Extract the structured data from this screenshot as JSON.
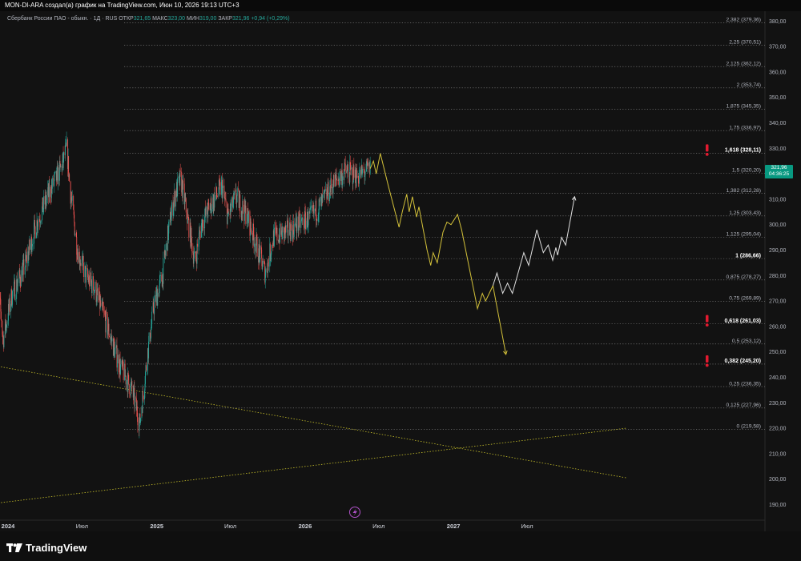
{
  "header": {
    "creator_line": "MON-DI-ARA создал(а) график на TradingView.com, Июн 10, 2026 19:13 UTC+3"
  },
  "legend": {
    "symbol": "Сбербанк России ПАО - обыкн. · 1Д · RUS",
    "open_label": "ОТКР",
    "open_value": "321,65",
    "high_label": "МАКС",
    "high_value": "323,00",
    "low_label": "МИН",
    "low_value": "319,00",
    "close_label": "ЗАКР",
    "close_value": "321,96",
    "change": "+0,94 (+0,29%)"
  },
  "price_tag": {
    "price": "321,96",
    "countdown": "04:36:25"
  },
  "brand": {
    "logo_text": "TradingView"
  },
  "colors": {
    "up": "#26a69a",
    "down": "#ef5350",
    "projection_yellow": "#d4c23a",
    "projection_white": "#e0e0e0",
    "fib_line": "#8a8a8a",
    "alert_red": "#e21a2f",
    "trendline": "#c9c22a"
  },
  "chart_data": {
    "type": "candlestick",
    "y_axis_ticks": [
      380,
      370,
      360,
      350,
      340,
      330,
      320,
      310,
      300,
      290,
      280,
      270,
      260,
      250,
      240,
      230,
      220,
      210,
      200,
      190
    ],
    "x_axis_labels": [
      "2024",
      "Июл",
      "2025",
      "Июл",
      "2026",
      "Июл",
      "2027",
      "Июл"
    ],
    "x_axis_label_dates": [
      "2024-01-01",
      "2024-07-01",
      "2025-01-01",
      "2025-07-01",
      "2026-01-01",
      "2026-07-01",
      "2027-01-01",
      "2027-07-01"
    ],
    "ylim": [
      187,
      382
    ],
    "fib_levels": [
      {
        "ratio": "2,382",
        "price": 379.36,
        "label": "2,382 (379,36)",
        "bold": false
      },
      {
        "ratio": "2,25",
        "price": 370.51,
        "label": "2,25 (370,51)",
        "bold": false
      },
      {
        "ratio": "2,125",
        "price": 362.12,
        "label": "2,125 (362,12)",
        "bold": false
      },
      {
        "ratio": "2",
        "price": 353.74,
        "label": "2 (353,74)",
        "bold": false
      },
      {
        "ratio": "1,875",
        "price": 345.35,
        "label": "1,875 (345,35)",
        "bold": false
      },
      {
        "ratio": "1,75",
        "price": 336.97,
        "label": "1,75 (336,97)",
        "bold": false
      },
      {
        "ratio": "1,618",
        "price": 328.11,
        "label": "1,618 (328,11)",
        "bold": true,
        "alert": true
      },
      {
        "ratio": "1,5",
        "price": 320.2,
        "label": "1,5 (320,20)",
        "bold": false
      },
      {
        "ratio": "1,382",
        "price": 312.28,
        "label": "1,382 (312,28)",
        "bold": false
      },
      {
        "ratio": "1,25",
        "price": 303.43,
        "label": "1,25 (303,43)",
        "bold": false
      },
      {
        "ratio": "1,125",
        "price": 295.04,
        "label": "1,125 (295,04)",
        "bold": false
      },
      {
        "ratio": "1",
        "price": 286.66,
        "label": "1 (286,66)",
        "bold": true
      },
      {
        "ratio": "0,875",
        "price": 278.27,
        "label": "0,875 (278,27)",
        "bold": false
      },
      {
        "ratio": "0,75",
        "price": 269.89,
        "label": "0,75 (269,89)",
        "bold": false
      },
      {
        "ratio": "0,618",
        "price": 261.03,
        "label": "0,618 (261,03)",
        "bold": true,
        "alert": true
      },
      {
        "ratio": "0,5",
        "price": 253.12,
        "label": "0,5 (253,12)",
        "bold": false
      },
      {
        "ratio": "0,382",
        "price": 245.2,
        "label": "0,382 (245,20)",
        "bold": true,
        "alert": true
      },
      {
        "ratio": "0,25",
        "price": 236.35,
        "label": "0,25 (236,35)",
        "bold": false
      },
      {
        "ratio": "0,125",
        "price": 227.96,
        "label": "0,125 (227,96)",
        "bold": false
      },
      {
        "ratio": "0",
        "price": 219.58,
        "label": "0 (219,58)",
        "bold": false
      }
    ],
    "price_anchors": [
      [
        "2023-12-01",
        287
      ],
      [
        "2023-12-20",
        255
      ],
      [
        "2024-01-10",
        272
      ],
      [
        "2024-02-10",
        283
      ],
      [
        "2024-03-10",
        300
      ],
      [
        "2024-04-10",
        312
      ],
      [
        "2024-05-10",
        322
      ],
      [
        "2024-05-25",
        330
      ],
      [
        "2024-06-01",
        315
      ],
      [
        "2024-06-20",
        290
      ],
      [
        "2024-07-10",
        280
      ],
      [
        "2024-08-01",
        275
      ],
      [
        "2024-09-01",
        260
      ],
      [
        "2024-10-01",
        245
      ],
      [
        "2024-11-01",
        235
      ],
      [
        "2024-11-20",
        222
      ],
      [
        "2024-12-10",
        250
      ],
      [
        "2024-12-25",
        268
      ],
      [
        "2025-01-15",
        280
      ],
      [
        "2025-02-01",
        300
      ],
      [
        "2025-02-15",
        312
      ],
      [
        "2025-03-01",
        318
      ],
      [
        "2025-03-15",
        305
      ],
      [
        "2025-04-05",
        285
      ],
      [
        "2025-04-20",
        300
      ],
      [
        "2025-05-15",
        308
      ],
      [
        "2025-06-10",
        315
      ],
      [
        "2025-06-25",
        303
      ],
      [
        "2025-07-15",
        311
      ],
      [
        "2025-08-10",
        304
      ],
      [
        "2025-09-01",
        293
      ],
      [
        "2025-09-25",
        281
      ],
      [
        "2025-10-15",
        295
      ],
      [
        "2025-11-15",
        297
      ],
      [
        "2025-12-15",
        300
      ],
      [
        "2026-01-15",
        303
      ],
      [
        "2026-02-10",
        308
      ],
      [
        "2026-03-10",
        316
      ],
      [
        "2026-04-10",
        321
      ],
      [
        "2026-05-10",
        319
      ],
      [
        "2026-06-10",
        322
      ]
    ],
    "projection_yellow": [
      [
        "2026-06-10",
        322
      ],
      [
        "2026-06-18",
        325
      ],
      [
        "2026-06-25",
        320
      ],
      [
        "2026-07-05",
        328
      ],
      [
        "2026-07-25",
        315
      ],
      [
        "2026-08-20",
        299
      ],
      [
        "2026-08-28",
        305
      ],
      [
        "2026-09-08",
        312
      ],
      [
        "2026-09-14",
        305
      ],
      [
        "2026-09-22",
        311
      ],
      [
        "2026-10-02",
        303
      ],
      [
        "2026-10-08",
        307
      ],
      [
        "2026-10-28",
        290
      ],
      [
        "2026-11-06",
        284
      ],
      [
        "2026-11-12",
        289
      ],
      [
        "2026-11-22",
        285
      ],
      [
        "2026-12-06",
        297
      ],
      [
        "2026-12-16",
        301
      ],
      [
        "2026-12-26",
        300
      ],
      [
        "2027-01-11",
        304
      ],
      [
        "2027-01-21",
        298
      ],
      [
        "2027-03-01",
        267
      ],
      [
        "2027-03-13",
        273
      ],
      [
        "2027-03-21",
        270
      ],
      [
        "2027-04-08",
        276
      ],
      [
        "2027-05-10",
        249
      ]
    ],
    "projection_white": [
      [
        "2027-04-08",
        276
      ],
      [
        "2027-04-18",
        281
      ],
      [
        "2027-05-02",
        273
      ],
      [
        "2027-05-14",
        277
      ],
      [
        "2027-05-26",
        273
      ],
      [
        "2027-06-23",
        289
      ],
      [
        "2027-07-05",
        284
      ],
      [
        "2027-07-25",
        298
      ],
      [
        "2027-08-10",
        289
      ],
      [
        "2027-08-22",
        292
      ],
      [
        "2027-09-02",
        286
      ],
      [
        "2027-09-10",
        291
      ],
      [
        "2027-09-14",
        288
      ],
      [
        "2027-09-24",
        295
      ],
      [
        "2027-10-04",
        292
      ],
      [
        "2027-10-26",
        311
      ]
    ],
    "trendlines": [
      {
        "from": [
          "2023-12-01",
          244.5
        ],
        "to": [
          "2028-03-01",
          200.5
        ]
      },
      {
        "from": [
          "2023-12-01",
          190.5
        ],
        "to": [
          "2028-03-01",
          220.0
        ]
      }
    ]
  }
}
